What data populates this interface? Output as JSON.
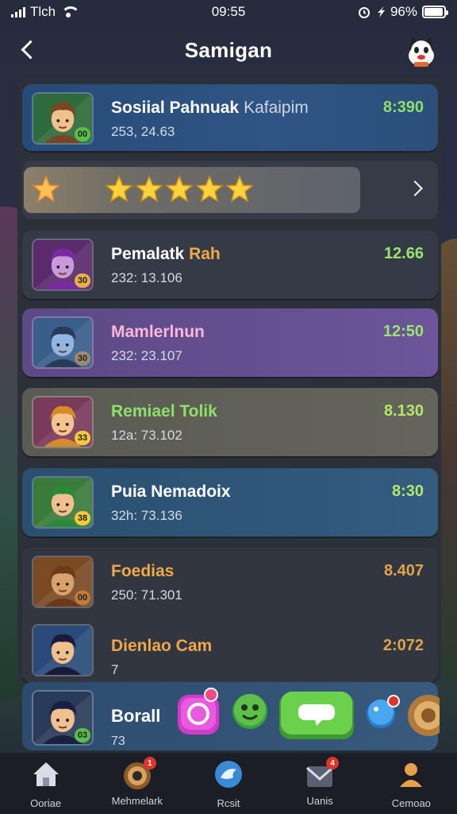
{
  "status_bar": {
    "carrier": "Tlch",
    "time": "09:55",
    "battery": "96%",
    "battery_level": 0.96
  },
  "header": {
    "title": "Samigan"
  },
  "rating": {
    "stars": 5
  },
  "players": [
    {
      "name": "Sosiial Pahnuak",
      "name_suffix": "Kafaipim",
      "sub": "253, 24.63",
      "score": "8:390",
      "score_color": "#8fe06a",
      "badge": "00",
      "badge_color": "#58c04a",
      "avatar_bg": "#2e6a3a",
      "skin": "#f1c08f",
      "hair": "#7a4520"
    },
    {
      "name": "Pemalatk",
      "name_accent": "Rah",
      "sub": "232: 13.106",
      "score": "12.66",
      "score_color": "#9be46f",
      "badge": "30",
      "badge_color": "#e8b04a",
      "avatar_bg": "#5a2a6a",
      "skin": "#c79ad9",
      "hair": "#7a2aa0"
    },
    {
      "name": "Mamlerlnun",
      "sub": "232: 23.107",
      "score": "12:50",
      "score_color": "#9be46f",
      "badge": "30",
      "badge_color": "#9a8a70",
      "avatar_bg": "#3a5e8a",
      "skin": "#8fb7df",
      "hair": "#2a3a5a"
    },
    {
      "name": "Remiael Tolik",
      "sub": "12a: 73.102",
      "score": "8.130",
      "score_color": "#b3e66a",
      "badge": "33",
      "badge_color": "#f2cb3a",
      "avatar_bg": "#7a3a5a",
      "skin": "#f4c48e",
      "hair": "#d68a2a"
    },
    {
      "name": "Puia Nemadoix",
      "sub": "32h: 73.136",
      "score": "8:30",
      "score_color": "#b3e66a",
      "badge": "38",
      "badge_color": "#f2cb3a",
      "avatar_bg": "#3a7a3a",
      "skin": "#f1c08f",
      "hair": "#2a8a3a"
    },
    {
      "name": "Foedias",
      "sub": "250: 71.301",
      "score": "8.407",
      "score_color": "#e0a44a",
      "badge": "00",
      "badge_color": "#c07a3a",
      "avatar_bg": "#7a4a22",
      "skin": "#d8a26a",
      "hair": "#6a3a1a"
    },
    {
      "name": "Dienlao Cam",
      "sub": "7",
      "score": "2:072",
      "score_color": "#e0a44a",
      "avatar_bg": "#2a4a7a",
      "skin": "#f1c08f",
      "hair": "#1a1a3a"
    },
    {
      "name": "Borall",
      "sub": "73",
      "badge": "03",
      "badge_color": "#58c04a",
      "avatar_bg": "#2a3a5a",
      "skin": "#f1c08f",
      "hair": "#1a2040"
    }
  ],
  "nav": [
    {
      "label": "Ooriae",
      "icon": "home-icon"
    },
    {
      "label": "Mehmelark",
      "icon": "target-icon",
      "notif": "1"
    },
    {
      "label": "Rcsit",
      "icon": "bird-icon"
    },
    {
      "label": "Uanis",
      "icon": "mail-icon",
      "notif": "4"
    },
    {
      "label": "Cemoao",
      "icon": "profile-icon"
    }
  ],
  "colors": {
    "name_green": "#8fe06a",
    "name_pink": "#ffb6d9",
    "name_orange": "#f0a848",
    "accent_yellow": "#ffd23a"
  }
}
